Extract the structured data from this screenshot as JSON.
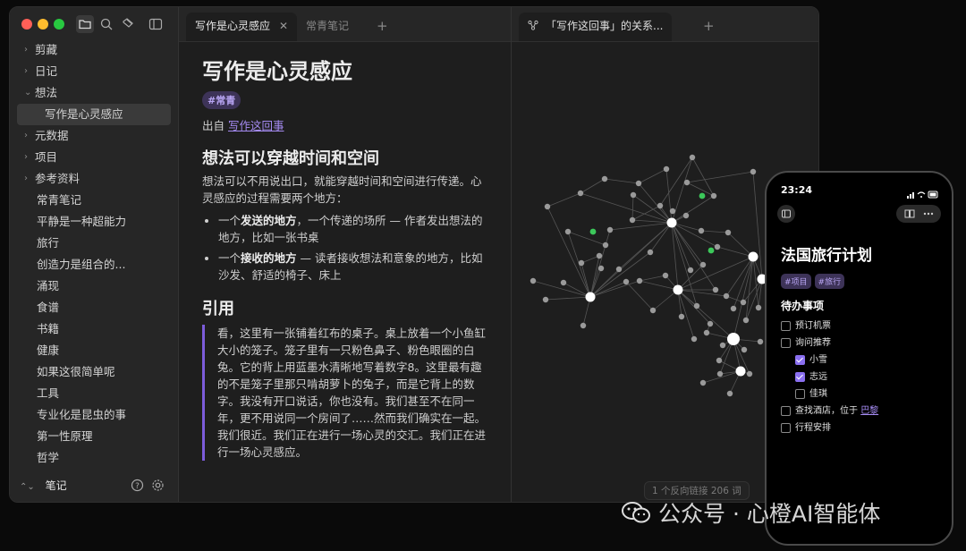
{
  "sidebar": {
    "tree": [
      {
        "label": "剪藏",
        "type": "folder",
        "expanded": false
      },
      {
        "label": "日记",
        "type": "folder",
        "expanded": false
      },
      {
        "label": "想法",
        "type": "folder",
        "expanded": true
      },
      {
        "label": "写作是心灵感应",
        "type": "file",
        "active": true,
        "child": true
      },
      {
        "label": "元数据",
        "type": "folder",
        "expanded": false
      },
      {
        "label": "项目",
        "type": "folder",
        "expanded": false
      },
      {
        "label": "参考资料",
        "type": "folder",
        "expanded": false
      },
      {
        "label": "常青笔记",
        "type": "file"
      },
      {
        "label": "平静是一种超能力",
        "type": "file"
      },
      {
        "label": "旅行",
        "type": "file"
      },
      {
        "label": "创造力是组合的...",
        "type": "file"
      },
      {
        "label": "涌现",
        "type": "file"
      },
      {
        "label": "食谱",
        "type": "file"
      },
      {
        "label": "书籍",
        "type": "file"
      },
      {
        "label": "健康",
        "type": "file"
      },
      {
        "label": "如果这很简单呢",
        "type": "file"
      },
      {
        "label": "工具",
        "type": "file"
      },
      {
        "label": "专业化是昆虫的事",
        "type": "file"
      },
      {
        "label": "第一性原理",
        "type": "file"
      },
      {
        "label": "哲学",
        "type": "file"
      }
    ],
    "vault_name": "笔记"
  },
  "tabs_left": {
    "active_label": "写作是心灵感应",
    "inactive_label": "常青笔记",
    "add": "+"
  },
  "note": {
    "title": "写作是心灵感应",
    "tag": "#常青",
    "from_prefix": "出自 ",
    "from_link": "写作这回事",
    "h2_1": "想法可以穿越时间和空间",
    "para_1": "想法可以不用说出口，就能穿越时间和空间进行传递。心灵感应的过程需要两个地方：",
    "bullet_1_a": "一个",
    "bullet_1_b": "发送的地方",
    "bullet_1_c": "，一个传递的场所 — 作者发出想法的地方，比如一张书桌",
    "bullet_2_a": "一个",
    "bullet_2_b": "接收的地方",
    "bullet_2_c": " — 读者接收想法和意象的地方，比如沙发、舒适的椅子、床上",
    "h2_2": "引用",
    "quote": "看，这里有一张铺着红布的桌子。桌上放着一个小鱼缸大小的笼子。笼子里有一只粉色鼻子、粉色眼圈的白兔。它的背上用蓝墨水清晰地写着数字8。这里最有趣的不是笼子里那只啃胡萝卜的兔子，而是它背上的数字。我没有开口说话，你也没有。我们甚至不在同一年，更不用说同一个房间了……然而我们确实在一起。我们很近。我们正在进行一场心灵的交汇。我们正在进行一场心灵感应。"
  },
  "graph_pane": {
    "tab_label": "「写作这回事」的关系...",
    "add": "+",
    "status": "1 个反向链接   206 词",
    "node_color": "#9a9a9a",
    "hub_color": "#ffffff",
    "accent_node_color": "#3cc85a"
  },
  "phone": {
    "time": "23:24",
    "title": "法国旅行计划",
    "tags": [
      "#项目",
      "#旅行"
    ],
    "section": "待办事项",
    "todos": [
      {
        "label": "预订机票",
        "checked": false,
        "sub": false
      },
      {
        "label": "询问推荐",
        "checked": false,
        "sub": false
      },
      {
        "label": "小雪",
        "checked": true,
        "sub": true
      },
      {
        "label": "志远",
        "checked": true,
        "sub": true
      },
      {
        "label": "佳琪",
        "checked": false,
        "sub": true
      },
      {
        "label": "查找酒店，位于 ",
        "link": "巴黎",
        "checked": false,
        "sub": false
      },
      {
        "label": "行程安排",
        "checked": false,
        "sub": false
      }
    ]
  },
  "watermark": "公众号 · 心橙AI智能体",
  "colors": {
    "accent": "#7c5cdb",
    "tag_bg": "#3d3358",
    "tag_fg": "#b9a6f4",
    "link": "#a58bf2"
  }
}
